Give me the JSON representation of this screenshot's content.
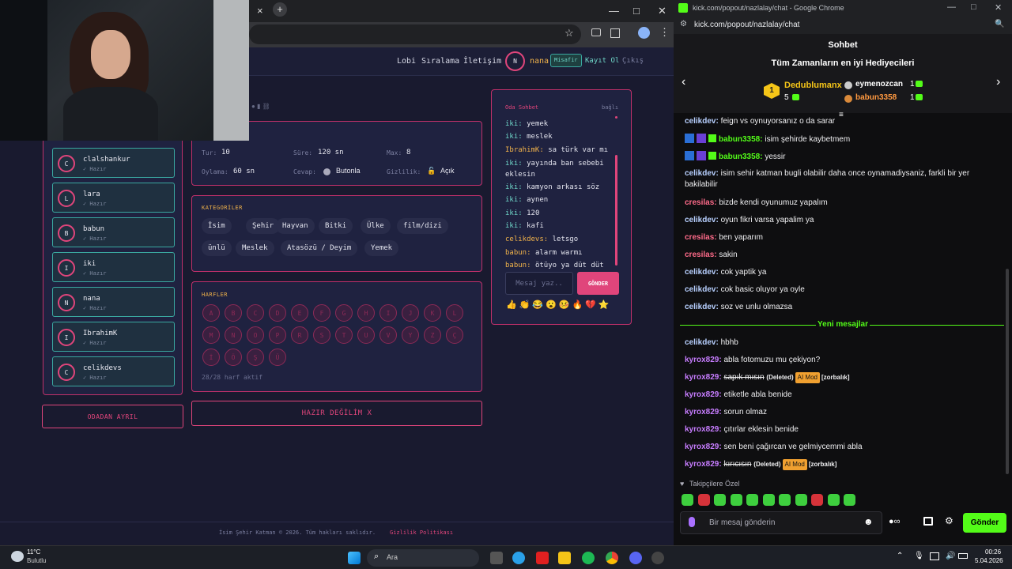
{
  "left_browser": {
    "tab_new": "+",
    "tab_close": "×",
    "win_min": "—",
    "win_max": "□",
    "win_close": "✕"
  },
  "site": {
    "nav": {
      "lobby": "Lobi",
      "ranking": "Sıralama",
      "contact": "İletişim",
      "avatar_letter": "N",
      "username": "nana",
      "guest_badge": "Misafir",
      "register": "Kayıt Ol",
      "logout": "Çıkış"
    },
    "players": [
      {
        "letter": "C",
        "name": "clalshankur",
        "status": "✓ Hazır"
      },
      {
        "letter": "L",
        "name": "lara",
        "status": "✓ Hazır"
      },
      {
        "letter": "B",
        "name": "babun",
        "status": "✓ Hazır"
      },
      {
        "letter": "I",
        "name": "iki",
        "status": "✓ Hazır"
      },
      {
        "letter": "N",
        "name": "nana",
        "status": "✓ Hazır"
      },
      {
        "letter": "I",
        "name": "IbrahimK",
        "status": "✓ Hazır"
      },
      {
        "letter": "C",
        "name": "celikdevs",
        "status": "✓ Hazır"
      }
    ],
    "leave_button": "ODADAN AYRIL",
    "settings": {
      "round_label": "Tur:",
      "round_value": "10",
      "time_label": "Süre:",
      "time_value": "120 sn",
      "max_label": "Max:",
      "max_value": "8",
      "vote_label": "Oylama:",
      "vote_value": "60 sn",
      "answer_label": "Cevap:",
      "answer_value": "Butonla",
      "privacy_label": "Gizlilik:",
      "privacy_value": "Açık"
    },
    "categories_title": "KATEGORİLER",
    "categories": [
      "İsim",
      "Şehir",
      "Hayvan",
      "Bitki",
      "Ülke",
      "film/dizi",
      "ünlü",
      "Meslek",
      "Atasözü / Deyim",
      "Yemek"
    ],
    "letters_title": "HARFLER",
    "letters": [
      "A",
      "B",
      "C",
      "D",
      "E",
      "F",
      "G",
      "H",
      "I",
      "J",
      "K",
      "L",
      "M",
      "N",
      "O",
      "P",
      "R",
      "S",
      "T",
      "U",
      "V",
      "Y",
      "Z",
      "Ç",
      "İ",
      "Ö",
      "Ş",
      "Ü"
    ],
    "letters_status": "28/28 harf aktif",
    "ready_button": "HAZIR DEĞİLİM X",
    "room_chat": {
      "title": "Oda Sohbet",
      "status": "bağlı",
      "messages": [
        {
          "user": "iki:",
          "text": "yemek"
        },
        {
          "user": "iki:",
          "text": "meslek"
        },
        {
          "user": "IbrahimK:",
          "text": "sa türk var mı"
        },
        {
          "user": "iki:",
          "text": "yayında ban sebebi"
        },
        {
          "user": "",
          "text": "eklesin"
        },
        {
          "user": "iki:",
          "text": "kamyon arkası söz"
        },
        {
          "user": "iki:",
          "text": "aynen"
        },
        {
          "user": "iki:",
          "text": "120"
        },
        {
          "user": "iki:",
          "text": "kafi"
        },
        {
          "user": "celikdevs:",
          "text": "letsgo"
        },
        {
          "user": "babun:",
          "text": "alarm warmı"
        },
        {
          "user": "babun:",
          "text": "ötüyo ya düt düt"
        }
      ],
      "input_placeholder": "Mesaj yaz..",
      "send_button": "GÖNDER"
    },
    "footer": "İsim Şehir Katman © 2026. Tüm hakları saklıdır.",
    "footer_link": "Gizlilik Politikası"
  },
  "right_browser": {
    "title": "kick.com/popout/nazlalay/chat - Google Chrome",
    "url": "kick.com/popout/nazlalay/chat",
    "chat_title": "Sohbet",
    "gifters_title": "Tüm Zamanların en iyi Hediyecileri",
    "gifters": [
      {
        "rank": "1",
        "name": "Dedublumanx",
        "count": "5"
      },
      {
        "name": "eymenozcan",
        "count": "1"
      },
      {
        "name": "babun3358",
        "count": "1"
      }
    ],
    "messages": [
      {
        "user": "celikdev:",
        "text": "feign vs oynuyorsanız o da sarar",
        "color": "#b8d0ff"
      },
      {
        "user": "babun3358:",
        "text": "isim şehirde kaybetmem",
        "color": "#53fc18"
      },
      {
        "user": "babun3358:",
        "text": "yessir",
        "color": "#53fc18"
      },
      {
        "user": "celikdev:",
        "text": "isim sehir katman bugli olabilir daha once oynamadiysaniz, farkli bir yer bakilabilir",
        "color": "#b8d0ff"
      },
      {
        "user": "cresilas:",
        "text": "bizde kendi oyunumuz yapalım",
        "color": "#ff6b8a"
      },
      {
        "user": "celikdev:",
        "text": "oyun fikri varsa yapalim ya",
        "color": "#b8d0ff"
      },
      {
        "user": "cresilas:",
        "text": "ben yaparım",
        "color": "#ff6b8a"
      },
      {
        "user": "cresilas:",
        "text": "sakin",
        "color": "#ff6b8a"
      },
      {
        "user": "celikdev:",
        "text": "cok yaptik ya",
        "color": "#b8d0ff"
      },
      {
        "user": "celikdev:",
        "text": "cok basic oluyor ya oyle",
        "color": "#b8d0ff"
      },
      {
        "user": "celikdev:",
        "text": "soz ve unlu olmazsa",
        "color": "#b8d0ff"
      }
    ],
    "new_messages": "Yeni mesajlar",
    "new": [
      {
        "user": "celikdev:",
        "text": "hbhb",
        "color": "#b8d0ff"
      },
      {
        "user": "kyrox829:",
        "text": "abla fotomuzu mu çekiyon?",
        "color": "#c77dff"
      },
      {
        "user": "kyrox829:",
        "text": "sapık mısın",
        "deleted": "(Deleted)",
        "mod": "AI Mod",
        "tag": "[zorbalık]",
        "color": "#c77dff"
      },
      {
        "user": "kyrox829:",
        "text": "etiketle abla benide",
        "color": "#c77dff"
      },
      {
        "user": "kyrox829:",
        "text": "sorun olmaz",
        "color": "#c77dff"
      },
      {
        "user": "kyrox829:",
        "text": "çıtırlar eklesin benide",
        "color": "#c77dff"
      },
      {
        "user": "kyrox829:",
        "text": "sen beni çağırcan ve gelmiycemmi abla",
        "color": "#c77dff"
      },
      {
        "user": "kyrox829:",
        "text": "kırıcısın",
        "deleted": "(Deleted)",
        "mod": "AI Mod",
        "tag": "[zorbalık]",
        "color": "#c77dff"
      }
    ],
    "followers_only": "Takipçilere Özel",
    "input_placeholder": "Bir mesaj gönderin",
    "send_button": "Gönder"
  },
  "taskbar": {
    "weather_temp": "11°C",
    "weather_text": "Bulutlu",
    "search_placeholder": "Ara",
    "time": "00:26",
    "date": "5.04.2026"
  }
}
